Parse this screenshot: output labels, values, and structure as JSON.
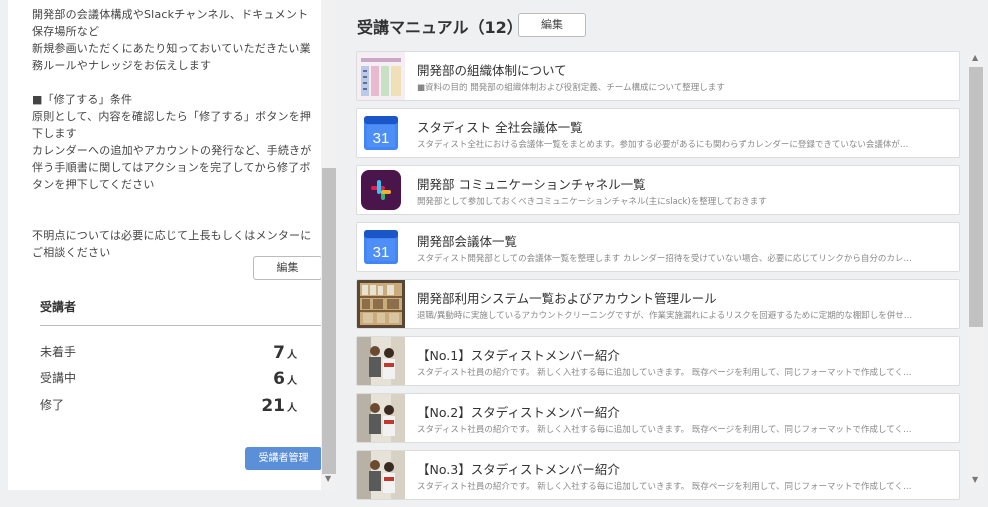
{
  "left_panel": {
    "paragraphs": [
      "開発部の会議体構成やSlackチャンネル、ドキュメント保存場所など\n新規参画いただくにあたり知っておいていただきたい業務ルールやナレッジをお伝えします",
      "■「修了する」条件\n原則として、内容を確認したら「修了する」ボタンを押下します\nカレンダーへの追加やアカウントの発行など、手続きが伴う手順書に関してはアクションを完了してから修了ボタンを押下してください",
      "不明点については必要に応じて上長もしくはメンターにご相談ください"
    ],
    "edit_label": "編集",
    "attendees_title": "受講者",
    "stats": [
      {
        "label": "未着手",
        "value": "7",
        "unit": "人"
      },
      {
        "label": "受講中",
        "value": "6",
        "unit": "人"
      },
      {
        "label": "修了",
        "value": "21",
        "unit": "人"
      }
    ],
    "manage_label": "受講者管理"
  },
  "header": {
    "title": "受講マニュアル（12）",
    "edit_label": "編集"
  },
  "manuals": [
    {
      "thumb": "org-chart-thumb",
      "title": "開発部の組織体制について",
      "desc": "■資料の目的 開発部の組織体制および役割定義、チーム構成について整理します"
    },
    {
      "thumb": "calendar-icon",
      "title": "スタディスト 全社会議体一覧",
      "desc": "スタディスト全社における会議体一覧をまとめます。参加する必要があるにも関わらずカレンダーに登録できていない会議体が…"
    },
    {
      "thumb": "slack-icon",
      "title": "開発部 コミュニケーションチャネル一覧",
      "desc": "開発部として参加しておくべきコミュニケーションチャネル(主にslack)を整理しておきます"
    },
    {
      "thumb": "calendar-icon",
      "title": "開発部会議体一覧",
      "desc": "スタディスト開発部としての会議体一覧を整理します カレンダー招待を受けていない場合、必要に応じてリンクから自分のカレ…"
    },
    {
      "thumb": "shelves-thumb",
      "title": "開発部利用システム一覧およびアカウント管理ルール",
      "desc": "退職/異動時に実施しているアカウントクリーニングですが、作業実施漏れによるリスクを回避するために定期的な棚卸しを併せ…"
    },
    {
      "thumb": "people-photo-thumb",
      "title": "【No.1】スタディストメンバー紹介",
      "desc": "スタディスト社員の紹介です。 新しく入社する毎に追加していきます。 既存ページを利用して、同じフォーマットで作成してく…"
    },
    {
      "thumb": "people-photo-thumb",
      "title": "【No.2】スタディストメンバー紹介",
      "desc": "スタディスト社員の紹介です。 新しく入社する毎に追加していきます。 既存ページを利用して、同じフォーマットで作成してく…"
    },
    {
      "thumb": "people-photo-thumb",
      "title": "【No.3】スタディストメンバー紹介",
      "desc": "スタディスト社員の紹介です。 新しく入社する毎に追加していきます。 既存ページを利用して、同じフォーマットで作成してく…"
    }
  ],
  "calendar_number": "31",
  "colors": {
    "accent": "#5b8fd8",
    "calendar_blue": "#4285f4",
    "slack_bg": "#4a154b"
  }
}
